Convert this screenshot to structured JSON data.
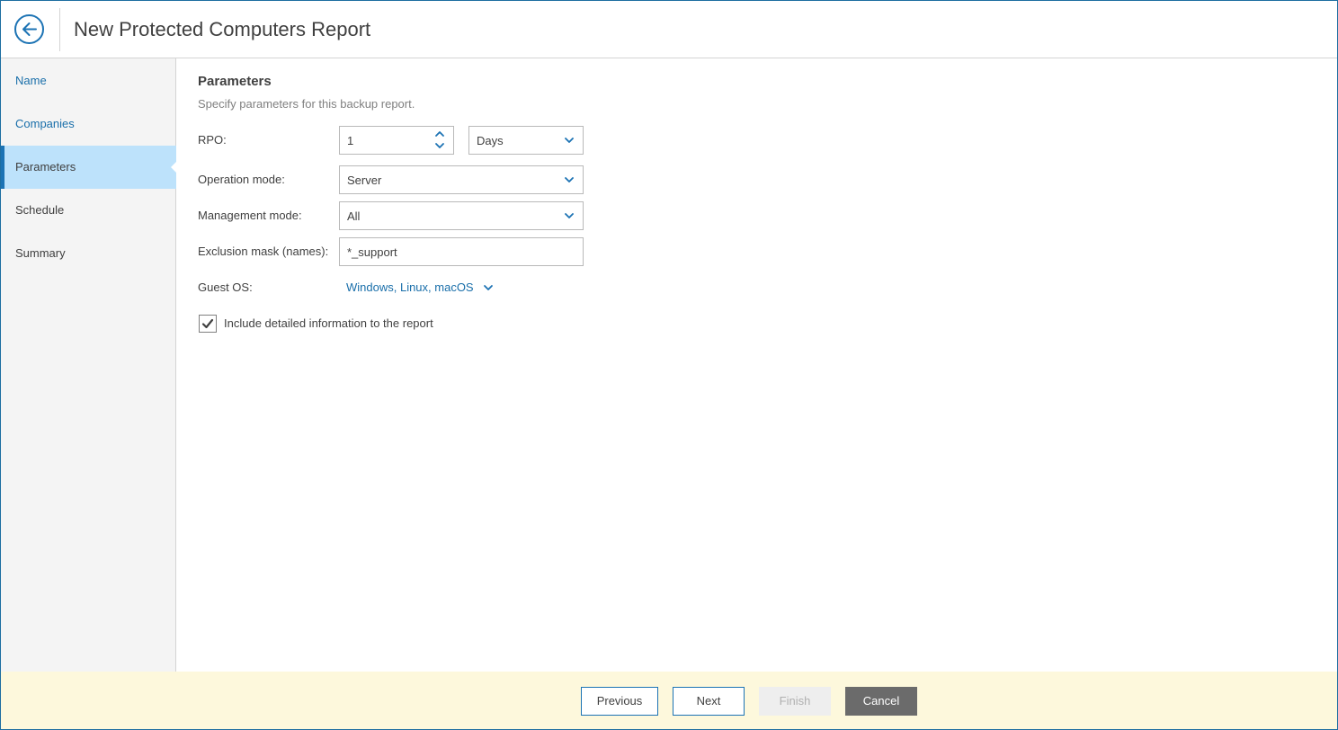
{
  "header": {
    "title": "New Protected Computers Report"
  },
  "sidebar": {
    "items": [
      {
        "label": "Name"
      },
      {
        "label": "Companies"
      },
      {
        "label": "Parameters"
      },
      {
        "label": "Schedule"
      },
      {
        "label": "Summary"
      }
    ]
  },
  "main": {
    "heading": "Parameters",
    "subtitle": "Specify parameters for this backup report.",
    "rpo": {
      "label": "RPO:",
      "value": "1",
      "unit": "Days"
    },
    "operation_mode": {
      "label": "Operation mode:",
      "value": "Server"
    },
    "management_mode": {
      "label": "Management mode:",
      "value": "All"
    },
    "exclusion_mask": {
      "label": "Exclusion mask (names):",
      "value": "*_support"
    },
    "guest_os": {
      "label": "Guest OS:",
      "value": "Windows, Linux, macOS"
    },
    "include_details": {
      "label": "Include detailed information to the report",
      "checked": true
    }
  },
  "footer": {
    "previous": "Previous",
    "next": "Next",
    "finish": "Finish",
    "cancel": "Cancel"
  },
  "colors": {
    "accent": "#1c73b4",
    "link": "#1a6faa",
    "active_nav": "#bde2fb",
    "footer_bg": "#fdf8dc"
  }
}
